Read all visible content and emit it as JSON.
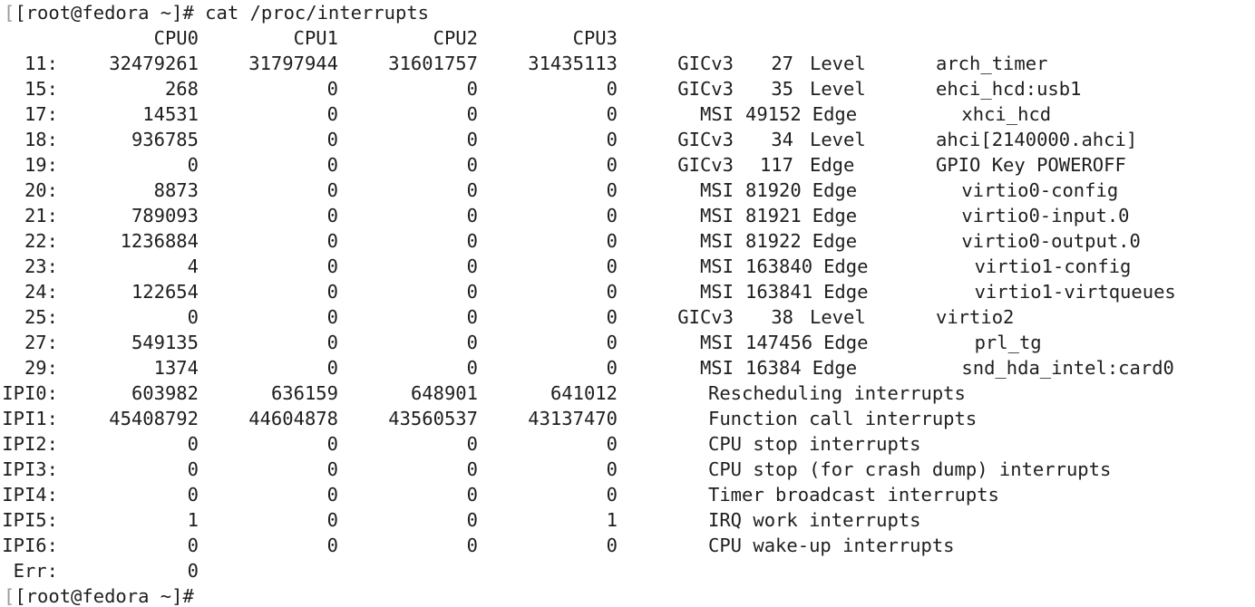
{
  "terminal": {
    "prompt": "[root@fedora ~]# ",
    "command": "cat /proc/interrupts",
    "final_prompt": "[root@fedora ~]#",
    "headers": [
      "CPU0",
      "CPU1",
      "CPU2",
      "CPU3"
    ],
    "rows": [
      {
        "irq": "11:",
        "counts": [
          "32479261",
          "31797944",
          "31601757",
          "31435113"
        ],
        "chip": "GICv3",
        "hwirq": "27",
        "type": "Level",
        "device": "arch_timer",
        "indent": 0
      },
      {
        "irq": "15:",
        "counts": [
          "268",
          "0",
          "0",
          "0"
        ],
        "chip": "GICv3",
        "hwirq": "35",
        "type": "Level",
        "device": "ehci_hcd:usb1",
        "indent": 0
      },
      {
        "irq": "17:",
        "counts": [
          "14531",
          "0",
          "0",
          "0"
        ],
        "chip": "MSI",
        "hwirq": "49152",
        "type": "Edge",
        "device": "xhci_hcd",
        "indent": 1
      },
      {
        "irq": "18:",
        "counts": [
          "936785",
          "0",
          "0",
          "0"
        ],
        "chip": "GICv3",
        "hwirq": "34",
        "type": "Level",
        "device": "ahci[2140000.ahci]",
        "indent": 0
      },
      {
        "irq": "19:",
        "counts": [
          "0",
          "0",
          "0",
          "0"
        ],
        "chip": "GICv3",
        "hwirq": "117",
        "type": "Edge",
        "device": "GPIO Key POWEROFF",
        "indent": 0
      },
      {
        "irq": "20:",
        "counts": [
          "8873",
          "0",
          "0",
          "0"
        ],
        "chip": "MSI",
        "hwirq": "81920",
        "type": "Edge",
        "device": "virtio0-config",
        "indent": 1
      },
      {
        "irq": "21:",
        "counts": [
          "789093",
          "0",
          "0",
          "0"
        ],
        "chip": "MSI",
        "hwirq": "81921",
        "type": "Edge",
        "device": "virtio0-input.0",
        "indent": 1
      },
      {
        "irq": "22:",
        "counts": [
          "1236884",
          "0",
          "0",
          "0"
        ],
        "chip": "MSI",
        "hwirq": "81922",
        "type": "Edge",
        "device": "virtio0-output.0",
        "indent": 1
      },
      {
        "irq": "23:",
        "counts": [
          "4",
          "0",
          "0",
          "0"
        ],
        "chip": "MSI",
        "hwirq": "163840",
        "type": "Edge",
        "device": "virtio1-config",
        "indent": 1
      },
      {
        "irq": "24:",
        "counts": [
          "122654",
          "0",
          "0",
          "0"
        ],
        "chip": "MSI",
        "hwirq": "163841",
        "type": "Edge",
        "device": "virtio1-virtqueues",
        "indent": 1
      },
      {
        "irq": "25:",
        "counts": [
          "0",
          "0",
          "0",
          "0"
        ],
        "chip": "GICv3",
        "hwirq": "38",
        "type": "Level",
        "device": "virtio2",
        "indent": 0
      },
      {
        "irq": "27:",
        "counts": [
          "549135",
          "0",
          "0",
          "0"
        ],
        "chip": "MSI",
        "hwirq": "147456",
        "type": "Edge",
        "device": "prl_tg",
        "indent": 1
      },
      {
        "irq": "29:",
        "counts": [
          "1374",
          "0",
          "0",
          "0"
        ],
        "chip": "MSI",
        "hwirq": "16384",
        "type": "Edge",
        "device": "snd_hda_intel:card0",
        "indent": 1
      }
    ],
    "ipi_rows": [
      {
        "irq": "IPI0:",
        "counts": [
          "603982",
          "636159",
          "648901",
          "641012"
        ],
        "desc": "Rescheduling interrupts"
      },
      {
        "irq": "IPI1:",
        "counts": [
          "45408792",
          "44604878",
          "43560537",
          "43137470"
        ],
        "desc": "Function call interrupts"
      },
      {
        "irq": "IPI2:",
        "counts": [
          "0",
          "0",
          "0",
          "0"
        ],
        "desc": "CPU stop interrupts"
      },
      {
        "irq": "IPI3:",
        "counts": [
          "0",
          "0",
          "0",
          "0"
        ],
        "desc": "CPU stop (for crash dump) interrupts"
      },
      {
        "irq": "IPI4:",
        "counts": [
          "0",
          "0",
          "0",
          "0"
        ],
        "desc": "Timer broadcast interrupts"
      },
      {
        "irq": "IPI5:",
        "counts": [
          "1",
          "0",
          "0",
          "1"
        ],
        "desc": "IRQ work interrupts"
      },
      {
        "irq": "IPI6:",
        "counts": [
          "0",
          "0",
          "0",
          "0"
        ],
        "desc": "CPU wake-up interrupts"
      }
    ],
    "err": {
      "irq": "Err:",
      "count": "0"
    }
  }
}
